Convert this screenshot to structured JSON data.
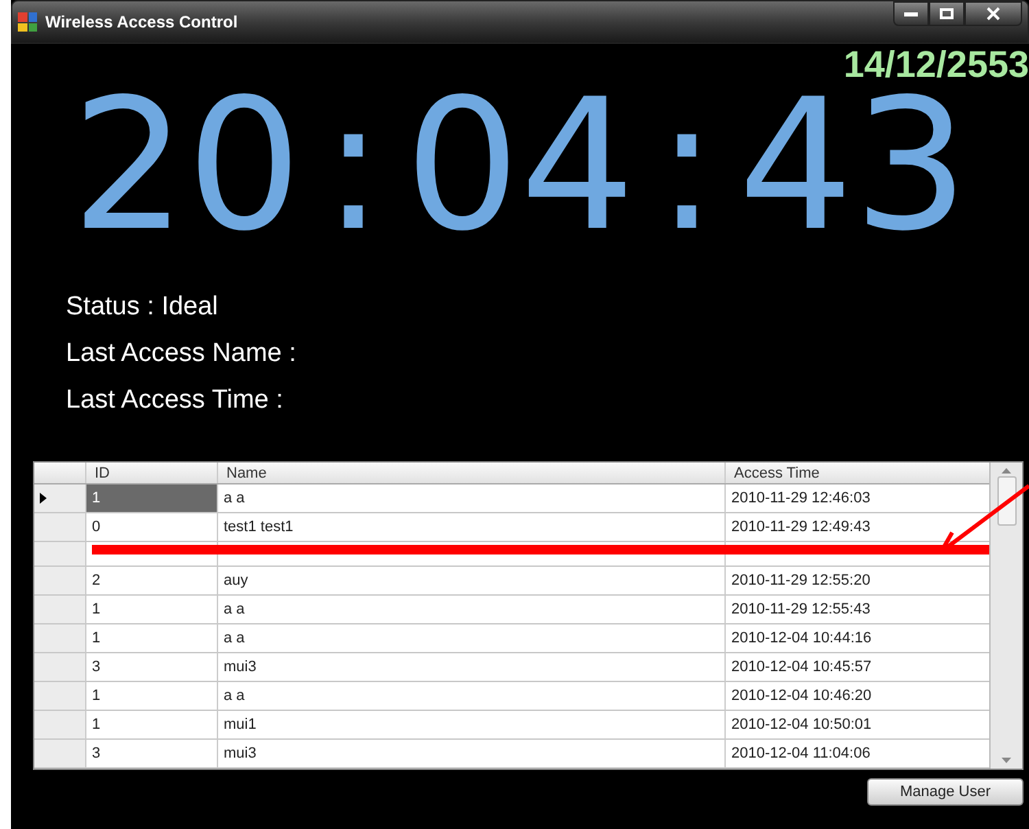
{
  "window": {
    "title": "Wireless Access Control"
  },
  "date": "14/12/2553",
  "clock": [
    "20",
    ":",
    "04",
    ":",
    "43"
  ],
  "info": [
    "Status : Ideal",
    "Last Access Name :",
    "Last Access Time :"
  ],
  "table": {
    "columns": [
      "ID",
      "Name",
      "Access Time"
    ],
    "rows": [
      {
        "id": "1",
        "name": "a a",
        "time": "2010-11-29 12:46:03",
        "selected": true
      },
      {
        "id": "0",
        "name": "test1 test1",
        "time": "2010-11-29 12:49:43",
        "selected": false
      },
      {
        "selected": false
      },
      {
        "id": "2",
        "name": "auy",
        "time": "2010-11-29 12:55:20",
        "selected": false
      },
      {
        "id": "1",
        "name": "a a",
        "time": "2010-11-29 12:55:43",
        "selected": false
      },
      {
        "id": "1",
        "name": "a a",
        "time": "2010-12-04 10:44:16",
        "selected": false
      },
      {
        "id": "3",
        "name": "mui3",
        "time": "2010-12-04 10:45:57",
        "selected": false
      },
      {
        "id": "1",
        "name": "a a",
        "time": "2010-12-04 10:46:20",
        "selected": false
      },
      {
        "id": "1",
        "name": "mui1",
        "time": "2010-12-04 10:50:01",
        "selected": false
      },
      {
        "id": "3",
        "name": "mui3",
        "time": "2010-12-04 11:04:06",
        "selected": false
      }
    ]
  },
  "buttons": [
    "Manage User"
  ]
}
